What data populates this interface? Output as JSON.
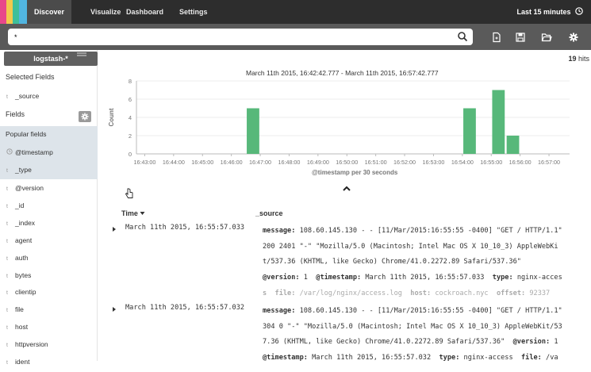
{
  "colors": {
    "logo_stripes": [
      "#e8488a",
      "#f2c94c",
      "#3ebf9a",
      "#51b5e0"
    ],
    "bar": "#57b87a",
    "nav_bg": "#2d2d2d",
    "searchbar_bg": "#5a5a5a"
  },
  "nav": {
    "tabs": [
      {
        "label": "Discover",
        "active": true
      },
      {
        "label": "Visualize",
        "active": false
      },
      {
        "label": "Dashboard",
        "active": false
      },
      {
        "label": "Settings",
        "active": false
      }
    ],
    "time_picker": "Last 15 minutes"
  },
  "search": {
    "query": "*",
    "icons": [
      "search-icon",
      "new-document-icon",
      "save-icon",
      "open-folder-icon",
      "gear-icon"
    ]
  },
  "sidebar": {
    "index_pattern": "logstash-*",
    "selected_fields_heading": "Selected Fields",
    "selected_fields": [
      {
        "type": "t",
        "name": "_source"
      }
    ],
    "fields_heading": "Fields",
    "popular_heading": "Popular fields",
    "popular_fields": [
      {
        "type": "clock",
        "name": "@timestamp"
      },
      {
        "type": "t",
        "name": "_type"
      }
    ],
    "other_fields": [
      {
        "type": "t",
        "name": "@version"
      },
      {
        "type": "t",
        "name": "_id"
      },
      {
        "type": "t",
        "name": "_index"
      },
      {
        "type": "t",
        "name": "agent"
      },
      {
        "type": "t",
        "name": "auth"
      },
      {
        "type": "t",
        "name": "bytes"
      },
      {
        "type": "t",
        "name": "clientip"
      },
      {
        "type": "t",
        "name": "file"
      },
      {
        "type": "t",
        "name": "host"
      },
      {
        "type": "t",
        "name": "httpversion"
      },
      {
        "type": "t",
        "name": "ident"
      }
    ]
  },
  "results": {
    "hits_count": "19",
    "hits_label": "hits",
    "time_range": "March 11th 2015, 16:42:42.777 - March 11th 2015, 16:57:42.777"
  },
  "chart_data": {
    "type": "bar",
    "xlabel": "@timestamp per 30 seconds",
    "ylabel": "Count",
    "ylim": [
      0,
      8
    ],
    "yticks": [
      0,
      2,
      4,
      6,
      8
    ],
    "xticks": [
      "16:43:00",
      "16:44:00",
      "16:45:00",
      "16:46:00",
      "16:47:00",
      "16:48:00",
      "16:49:00",
      "16:50:00",
      "16:51:00",
      "16:52:00",
      "16:53:00",
      "16:54:00",
      "16:55:00",
      "16:56:00",
      "16:57:00"
    ],
    "bars": [
      {
        "x": "16:46:30",
        "value": 5
      },
      {
        "x": "16:54:00",
        "value": 5
      },
      {
        "x": "16:55:00",
        "value": 7
      },
      {
        "x": "16:55:30",
        "value": 2
      }
    ],
    "grid": true
  },
  "table": {
    "col_time": "Time",
    "col_source": "_source",
    "rows": [
      {
        "time": "March 11th 2015, 16:55:57.033",
        "lines": [
          [
            {
              "k": "message:",
              "v": " 108.60.145.130 - - [11/Mar/2015:16:55:55 -0400] \"GET / HTTP/1.1\""
            }
          ],
          [
            {
              "v": "200 2401 \"-\" \"Mozilla/5.0 (Macintosh; Intel Mac OS X 10_10_3) AppleWebKi"
            }
          ],
          [
            {
              "v": "t/537.36 (KHTML, like Gecko) Chrome/41.0.2272.89 Safari/537.36\""
            }
          ],
          [
            {
              "k": "@version:",
              "v": " 1  "
            },
            {
              "k": "@timestamp:",
              "v": " March 11th 2015, 16:55:57.033  "
            },
            {
              "k": "type:",
              "v": " nginx-acces"
            }
          ],
          [
            {
              "k": "s  file:",
              "v": " /var/log/nginx/access.log  ",
              "faded": true
            },
            {
              "k": "host:",
              "v": " cockroach.nyc  ",
              "faded": true
            },
            {
              "k": "offset:",
              "v": " 92337",
              "faded": true
            }
          ]
        ]
      },
      {
        "time": "March 11th 2015, 16:55:57.032",
        "lines": [
          [
            {
              "k": "message:",
              "v": " 108.60.145.130 - - [11/Mar/2015:16:55:55 -0400] \"GET / HTTP/1.1\""
            }
          ],
          [
            {
              "v": "304 0 \"-\" \"Mozilla/5.0 (Macintosh; Intel Mac OS X 10_10_3) AppleWebKit/53"
            }
          ],
          [
            {
              "v": "7.36 (KHTML, like Gecko) Chrome/41.0.2272.89 Safari/537.36\"  "
            },
            {
              "k": "@version:",
              "v": " 1"
            }
          ],
          [
            {
              "k": "@timestamp:",
              "v": " March 11th 2015, 16:55:57.032  "
            },
            {
              "k": "type:",
              "v": " nginx-access  "
            },
            {
              "k": "file:",
              "v": " /va"
            }
          ]
        ]
      }
    ]
  }
}
